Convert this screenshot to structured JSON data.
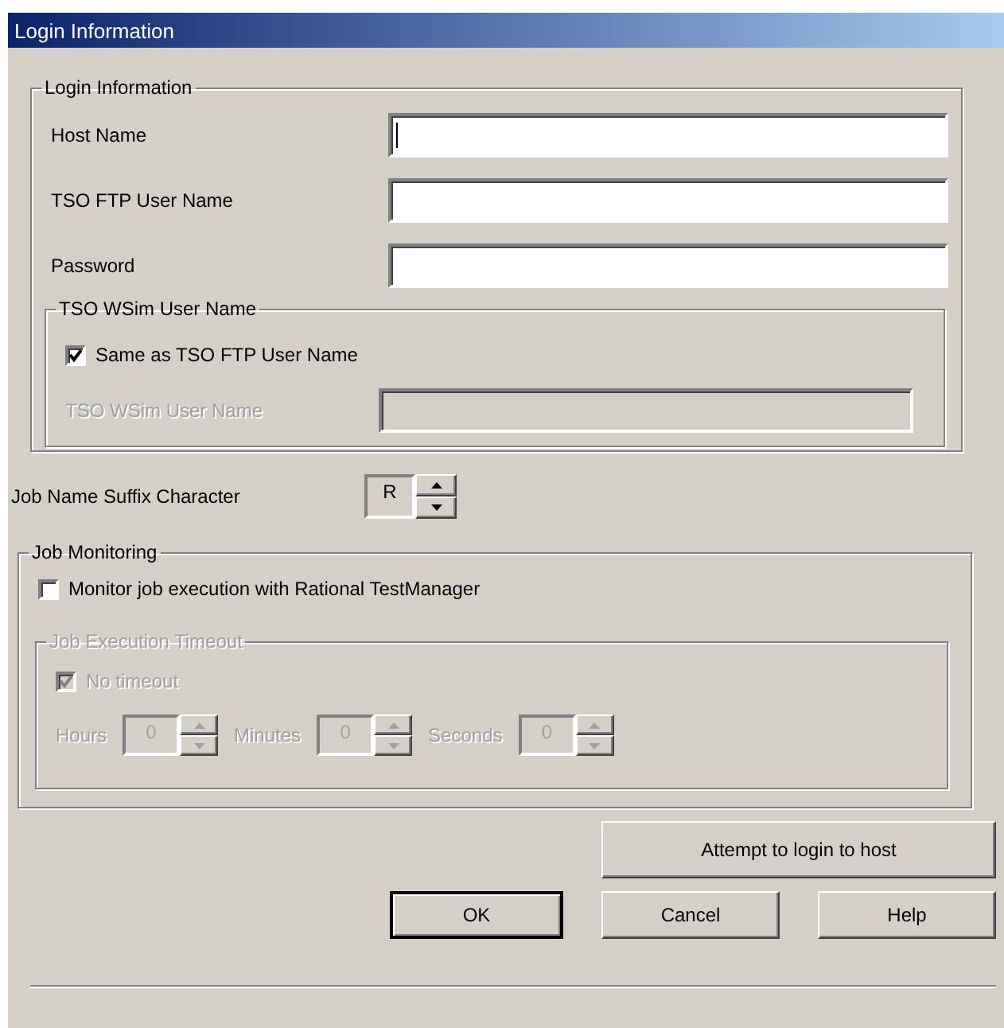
{
  "window": {
    "title": "Login Information"
  },
  "login_group": {
    "title": "Login Information",
    "fields": [
      {
        "label": "Host Name",
        "focused": true
      },
      {
        "label": "TSO FTP User Name",
        "focused": false
      },
      {
        "label": "Password",
        "focused": false
      }
    ],
    "wsim_group": {
      "title": "TSO WSim User Name",
      "checkbox": {
        "label": "Same as TSO FTP User Name",
        "checked": true
      },
      "field": {
        "label": "TSO WSim User Name",
        "disabled": true
      }
    }
  },
  "suffix": {
    "label": "Job Name Suffix Character",
    "value": "R"
  },
  "monitoring": {
    "title": "Job Monitoring",
    "checkbox": {
      "label": "Monitor job execution with Rational TestManager",
      "checked": false
    },
    "timeout_group": {
      "title": "Job Execution Timeout",
      "disabled": true,
      "checkbox": {
        "label": "No timeout",
        "checked": true
      },
      "spinners": [
        {
          "label": "Hours",
          "value": "0"
        },
        {
          "label": "Minutes",
          "value": "0"
        },
        {
          "label": "Seconds",
          "value": "0"
        }
      ]
    }
  },
  "buttons": [
    {
      "label": "Attempt to login to host",
      "kind": "wide",
      "default": false
    },
    {
      "label": "OK",
      "kind": "normal",
      "default": true
    },
    {
      "label": "Cancel",
      "kind": "normal",
      "default": false
    },
    {
      "label": "Help",
      "kind": "normal",
      "default": false
    }
  ]
}
